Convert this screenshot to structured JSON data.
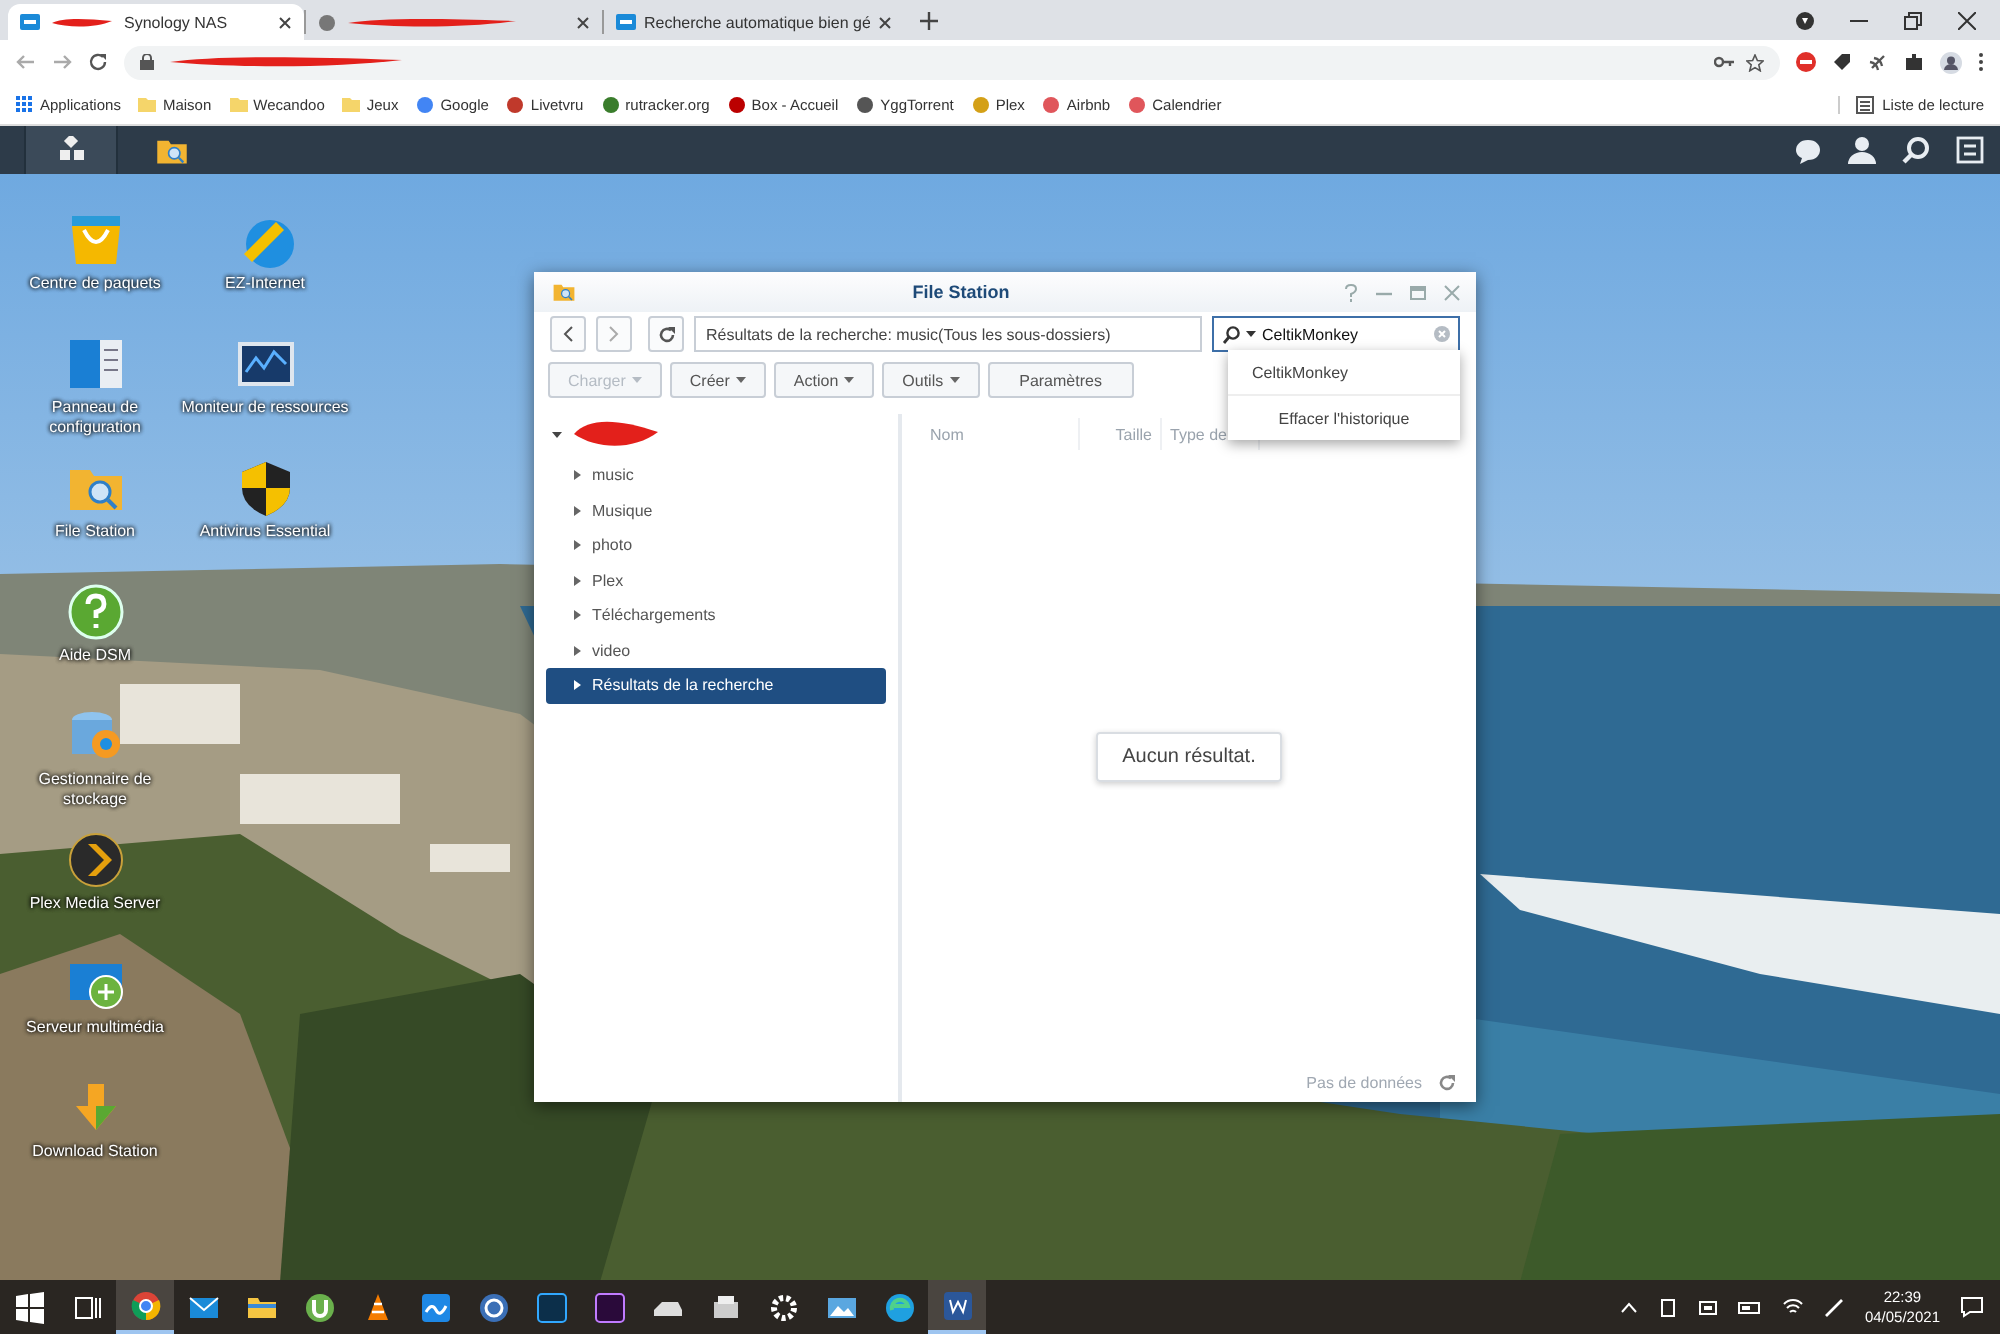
{
  "browser": {
    "tabs": [
      {
        "title": "Synology NAS",
        "redacted": true,
        "selected": true
      },
      {
        "redacted": true,
        "selected": false
      },
      {
        "title": "Recherche automatique bien gé",
        "redacted": false,
        "selected": false
      }
    ],
    "address": {
      "redacted": true
    },
    "bookmarks": [
      {
        "kind": "apps",
        "label": "Applications"
      },
      {
        "kind": "folder",
        "label": "Maison"
      },
      {
        "kind": "folder",
        "label": "Wecandoo"
      },
      {
        "kind": "folder",
        "label": "Jeux"
      },
      {
        "kind": "site",
        "label": "Google"
      },
      {
        "kind": "site",
        "label": "Livetvru"
      },
      {
        "kind": "site",
        "label": "rutracker.org"
      },
      {
        "kind": "site",
        "label": "Box - Accueil"
      },
      {
        "kind": "site",
        "label": "YggTorrent"
      },
      {
        "kind": "site",
        "label": "Plex"
      },
      {
        "kind": "site",
        "label": "Airbnb"
      },
      {
        "kind": "site",
        "label": "Calendrier"
      }
    ],
    "reading_list": "Liste de lecture"
  },
  "desktop": {
    "icons": [
      {
        "label": "Centre de paquets"
      },
      {
        "label": "EZ-Internet"
      },
      {
        "label": "Panneau de configuration"
      },
      {
        "label": "Moniteur de ressources"
      },
      {
        "label": "File Station"
      },
      {
        "label": "Antivirus Essential"
      },
      {
        "label": "Aide DSM"
      },
      {
        "label": "Gestionnaire de stockage"
      },
      {
        "label": "Plex Media Server"
      },
      {
        "label": "Serveur multimédia"
      },
      {
        "label": "Download Station"
      }
    ]
  },
  "file_station": {
    "title": "File Station",
    "path": "Résultats de la recherche: music(Tous les sous-dossiers)",
    "search": {
      "value": "CeltikMonkey"
    },
    "buttons": [
      {
        "label": "Charger",
        "dropdown": true,
        "disabled": true
      },
      {
        "label": "Créer",
        "dropdown": true,
        "disabled": false
      },
      {
        "label": "Action",
        "dropdown": true,
        "disabled": false
      },
      {
        "label": "Outils",
        "dropdown": true,
        "disabled": false
      },
      {
        "label": "Paramètres",
        "dropdown": false,
        "disabled": false
      }
    ],
    "tree": {
      "redacted": true,
      "expanded": true,
      "children": [
        {
          "label": "music",
          "selected": false
        },
        {
          "label": "Musique",
          "selected": false
        },
        {
          "label": "photo",
          "selected": false
        },
        {
          "label": "Plex",
          "selected": false
        },
        {
          "label": "Téléchargements",
          "selected": false
        },
        {
          "label": "video",
          "selected": false
        },
        {
          "label": "Résultats de la recherche",
          "selected": true
        }
      ]
    },
    "columns": [
      "Nom",
      "Taille",
      "Type de"
    ],
    "message": "Aucun résultat.",
    "footer": "Pas de données",
    "history": [
      "CeltikMonkey",
      "Effacer l'historique"
    ]
  },
  "taskbar": {
    "time": "22:39",
    "date": "04/05/2021"
  }
}
